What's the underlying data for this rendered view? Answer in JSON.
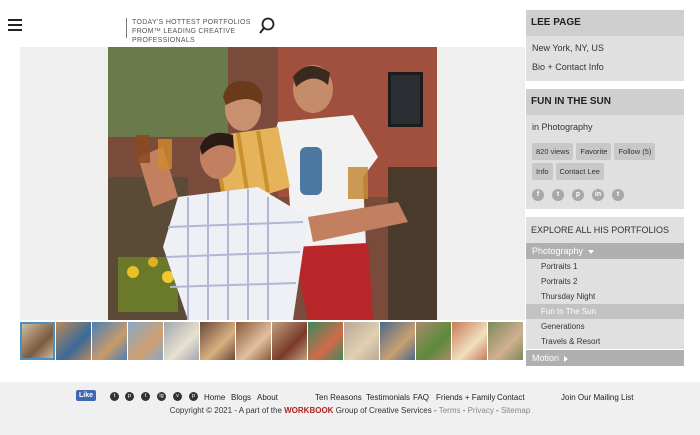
{
  "header": {
    "tagline": "Today's hottest portfolios from™ leading creative professionals",
    "menu_icon": "hamburger-icon",
    "search_icon": "search-icon"
  },
  "artist": {
    "name": "LEE PAGE",
    "location": "New York, NY, US",
    "bio_link": "Bio + Contact Info"
  },
  "portfolio": {
    "title": "FUN IN THE SUN",
    "category": "in Photography",
    "buttons": [
      "820 views",
      "Favorite",
      "Follow (5)",
      "Info",
      "Contact Lee"
    ],
    "social": [
      "f",
      "t",
      "p",
      "in",
      "t"
    ]
  },
  "explore": {
    "heading": "EXPLORE ALL HIS PORTFOLIOS",
    "category": "Photography",
    "items": [
      "Portraits 1",
      "Portraits 2",
      "Thursday Night",
      "Fun In The Sun",
      "Generations",
      "Travels & Resort"
    ],
    "active_index": 3,
    "next_category": "Motion"
  },
  "thumbnails": {
    "count": 14,
    "active_index": 0
  },
  "footer": {
    "like": "Like",
    "social": [
      "t",
      "p",
      "t",
      "ig",
      "v",
      "p"
    ],
    "links": [
      "Home",
      "Blogs",
      "About",
      "Ten Reasons",
      "Testimonials",
      "FAQ",
      "Friends + Family",
      "Contact",
      "Join Our Mailing List"
    ],
    "copyright_prefix": "Copyright © 2021 - A part of the",
    "brand": "WORKBOOK",
    "copyright_suffix": "Group of Creative Services -",
    "terms": "Terms",
    "privacy": "Privacy",
    "sitemap": "Sitemap"
  }
}
